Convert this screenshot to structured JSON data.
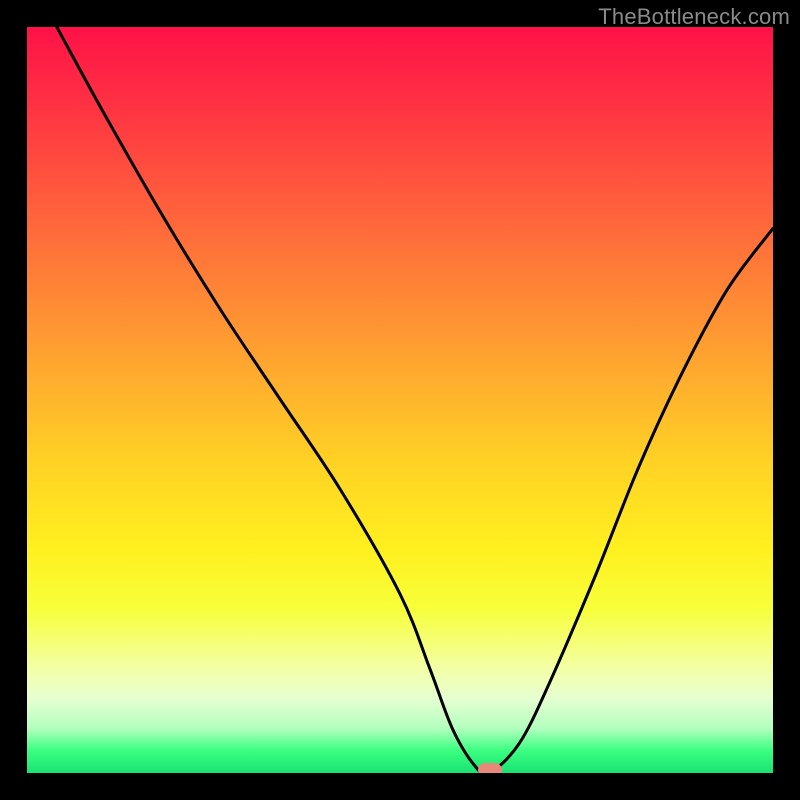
{
  "attribution": "TheBottleneck.com",
  "colors": {
    "frame": "#000000",
    "curve": "#000000",
    "marker": "#e9877b",
    "gradient_stops": [
      "#ff1248",
      "#ff2a44",
      "#ff4b3f",
      "#ff6d3a",
      "#ff8e34",
      "#ffb02d",
      "#ffd124",
      "#fff01f",
      "#f7ff3a",
      "#f3ffa6",
      "#e6ffd1",
      "#b3ffbe",
      "#3bff80",
      "#18e272"
    ]
  },
  "chart_data": {
    "type": "line",
    "title": "",
    "xlabel": "",
    "ylabel": "",
    "xlim": [
      0,
      100
    ],
    "ylim": [
      0,
      100
    ],
    "grid": false,
    "legend": false,
    "series": [
      {
        "name": "bottleneck-curve",
        "x": [
          4,
          10,
          18,
          26,
          34,
          42,
          50,
          54,
          57,
          60,
          62,
          66,
          70,
          76,
          82,
          88,
          94,
          100
        ],
        "y": [
          100,
          89,
          75,
          62,
          50,
          38,
          24,
          14,
          6,
          1,
          0,
          4,
          12,
          26,
          41,
          54,
          65,
          73
        ]
      }
    ],
    "marker": {
      "x": 62,
      "y": 0
    }
  }
}
